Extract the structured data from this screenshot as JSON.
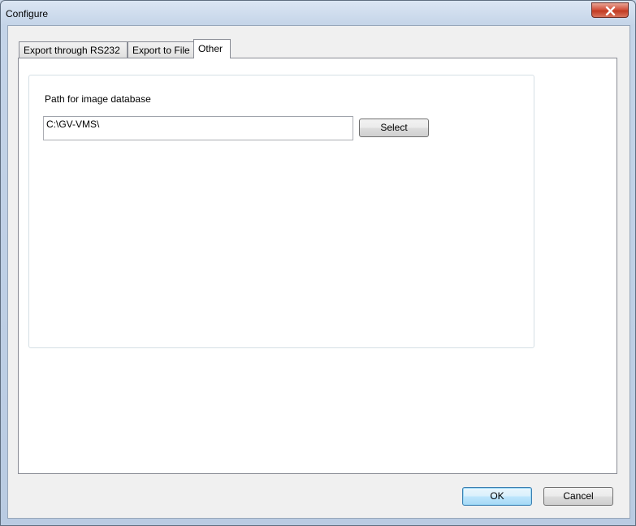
{
  "window": {
    "title": "Configure"
  },
  "tabs": [
    {
      "label": "Export through RS232",
      "active": false
    },
    {
      "label": "Export to File",
      "active": false
    },
    {
      "label": "Other",
      "active": true
    }
  ],
  "other_tab": {
    "path_label": "Path for image database",
    "path_value": "C:\\GV-VMS\\",
    "select_label": "Select"
  },
  "footer": {
    "ok_label": "OK",
    "cancel_label": "Cancel"
  },
  "icons": {
    "close": "close-icon"
  },
  "colors": {
    "close_button": "#c23b22",
    "default_button_border": "#3c7fb1"
  }
}
